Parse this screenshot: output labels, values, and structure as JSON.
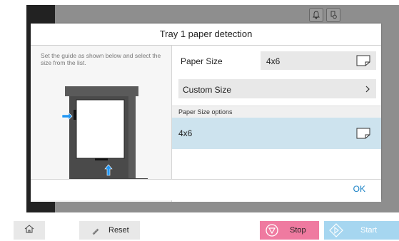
{
  "dialog": {
    "title": "Tray 1 paper detection",
    "instruction": "Set the guide as shown below and select the size from the list.",
    "paper_size_label": "Paper Size",
    "paper_size_value": "4x6",
    "custom_size_label": "Custom Size",
    "options_header": "Paper Size options",
    "options": [
      {
        "label": "4x6",
        "selected": true
      }
    ],
    "ok_label": "OK"
  },
  "bottom_bar": {
    "reset_label": "Reset",
    "stop_label": "Stop",
    "start_label": "Start"
  },
  "icons": {
    "bell": "bell-icon",
    "job_status": "job-status-icon",
    "paper": "paper-icon",
    "home": "home-icon"
  },
  "colors": {
    "accent": "#1a82c6",
    "selected_row": "#cde3ee",
    "stop": "#ef7aa0",
    "start": "#a6d6f0",
    "guide_arrow": "#2196f3"
  }
}
